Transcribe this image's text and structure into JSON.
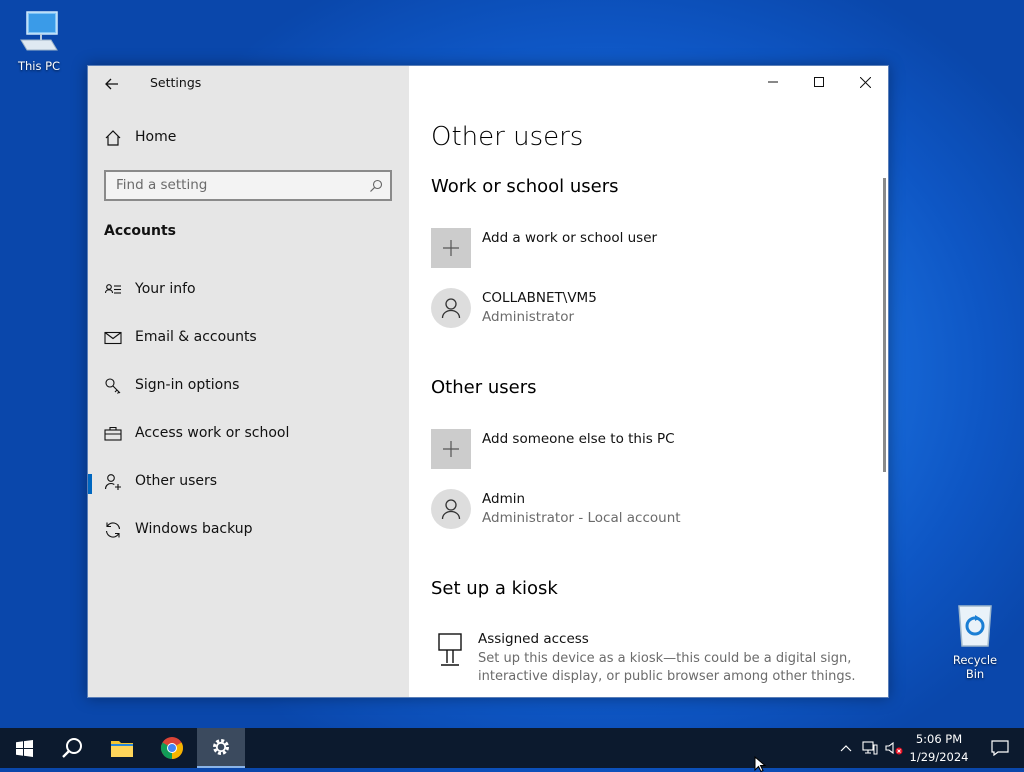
{
  "desktop": {
    "icons": [
      {
        "label": "This PC"
      },
      {
        "label": "Recycle Bin"
      }
    ]
  },
  "window": {
    "app_title": "Settings",
    "controls": {
      "minimize": "minimize-icon",
      "maximize": "maximize-icon",
      "close": "close-icon"
    }
  },
  "nav": {
    "home_label": "Home",
    "search_placeholder": "Find a setting",
    "section_title": "Accounts",
    "items": [
      {
        "label": "Your info",
        "icon": "contact-card-icon"
      },
      {
        "label": "Email & accounts",
        "icon": "mail-icon"
      },
      {
        "label": "Sign-in options",
        "icon": "key-icon"
      },
      {
        "label": "Access work or school",
        "icon": "briefcase-icon"
      },
      {
        "label": "Other users",
        "icon": "person-add-icon",
        "selected": true
      },
      {
        "label": "Windows backup",
        "icon": "sync-icon"
      }
    ]
  },
  "content": {
    "page_title": "Other users",
    "work_section": {
      "heading": "Work or school users",
      "add_label": "Add a work or school user",
      "users": [
        {
          "name": "COLLABNET\\VM5",
          "role": "Administrator"
        }
      ]
    },
    "other_section": {
      "heading": "Other users",
      "add_label": "Add someone else to this PC",
      "users": [
        {
          "name": "Admin",
          "role": "Administrator - Local account"
        }
      ]
    },
    "kiosk_section": {
      "heading": "Set up a kiosk",
      "item_title": "Assigned access",
      "item_desc_line1": "Set up this device as a kiosk—this could be a digital sign,",
      "item_desc_line2": "interactive display, or public browser among other things."
    }
  },
  "taskbar": {
    "time": "5:06 PM",
    "date": "1/29/2024",
    "accent": "#0c1a2e"
  }
}
